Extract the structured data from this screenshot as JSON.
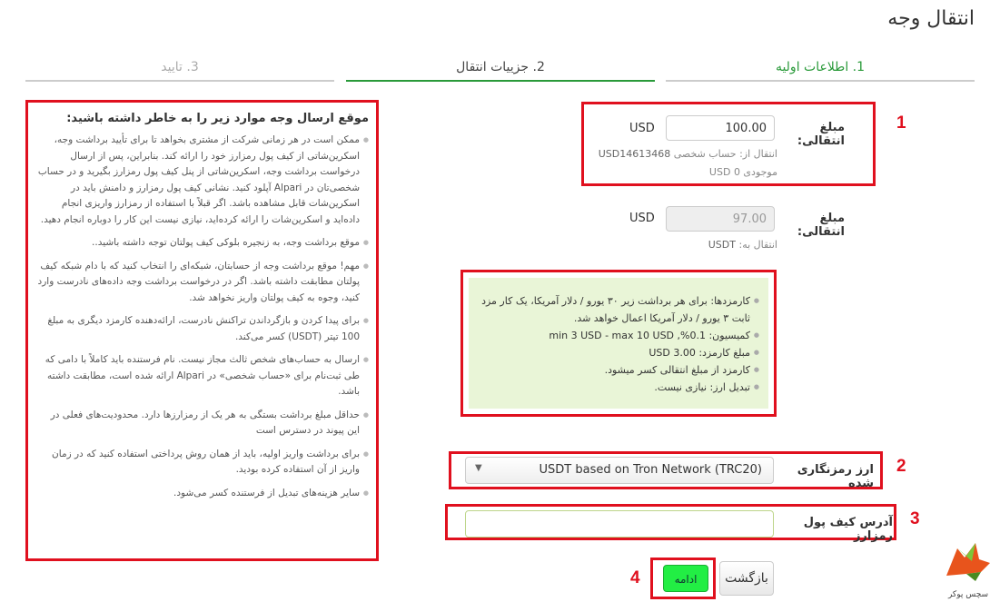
{
  "page": {
    "title": "انتقال وجه"
  },
  "steps": [
    {
      "label": "1. اطلاعات اولیه"
    },
    {
      "label": "2. جزییات انتقال"
    },
    {
      "label": "3. تایید"
    }
  ],
  "annotations": {
    "n1": "1",
    "n2": "2",
    "n3": "3",
    "n4": "4"
  },
  "amount": {
    "label": "مبلغ انتقالی:",
    "value": "100.00",
    "currency": "USD",
    "from_label": "انتقال از: حساب شخصی",
    "from_account": "USD14613468",
    "balance": "موجودی 0 USD"
  },
  "received": {
    "label": "مبلغ انتقالی:",
    "value": "97.00",
    "currency": "USD",
    "to_label": "انتقال به:",
    "to_value": "USDT"
  },
  "fees": [
    "کارمزدها: برای هر برداشت زیر ۳۰ یورو / دلار آمریکا، یک کار مزد ثابت ۳ یورو / دلار آمریکا اعمال خواهد شد.",
    "کمیسیون: 0.1%, min 3 USD - max 10 USD",
    "مبلغ کارمزد: 3.00 USD",
    "کارمزد از مبلغ انتقالی کسر میشود.",
    "تبدیل ارز: نیازی نیست."
  ],
  "crypto": {
    "label": "ارز رمزنگاری شده",
    "selected": "USDT based on Tron Network (TRC20)"
  },
  "wallet": {
    "label": "آدرس کیف پول رمزارز",
    "value": ""
  },
  "buttons": {
    "back": "بازگشت",
    "continue": "ادامه"
  },
  "notice": {
    "title": "موقع ارسال وجه موارد زیر را به خاطر داشته باشید:",
    "items": [
      "ممکن است در هر زمانی شرکت از مشتری بخواهد تا برای تأیید برداشت وجه، اسکرین‌شاتی از کیف پول رمزارز خود را ارائه کند. بنابراین، پس از ارسال درخواست برداشت وجه، اسکرین‌شاتی از پنل کیف پول رمزارز بگیرید و در حساب شخصی‌تان در Alpari آپلود کنید. نشانی کیف پول رمزارز و دامنش باید در اسکرین‌شات قابل مشاهده باشد. اگر قبلاً با استفاده از رمزارز واریزی انجام داده‌اید و اسکرین‌شات را ارائه کرده‌اید، نیازی نیست این کار را دوباره انجام دهید.",
      "موقع برداشت وجه، به زنجیره بلوکی کیف پولتان توجه داشته باشید..",
      "مهم! موقع برداشت وجه از حسابتان، شبکه‌ای را انتخاب کنید که با دام شبکه کیف پولتان مطابقت داشته باشد. اگر در درخواست برداشت وجه داده‌های نادرست وارد کنید، وجوه به کیف پولتان واریز نخواهد شد.",
      "برای پیدا کردن و بازگرداندن تراکنش نادرست، ارائه‌دهنده کارمزد دیگری به مبلغ 100 تیتر (USDT) کسر می‌کند.",
      "ارسال به حساب‌های شخص ثالث مجاز نیست. نام فرستنده باید کاملاً با دامی که طی ثبت‌نام برای «حساب شخصی» در Alpari ارائه شده است، مطابقت داشته باشد.",
      "حداقل مبلغ برداشت بستگی به هر یک از رمزارزها دارد. محدودیت‌های فعلی در این پیوند در دسترس است",
      "برای برداشت واریز اولیه، باید از همان روش پرداختی استفاده کنید که در زمان واریز از آن استفاده کرده بودید.",
      "سایر هزینه‌های تبدیل از فرستنده کسر می‌شود."
    ]
  },
  "logo": {
    "text": "سچس پوکر"
  }
}
